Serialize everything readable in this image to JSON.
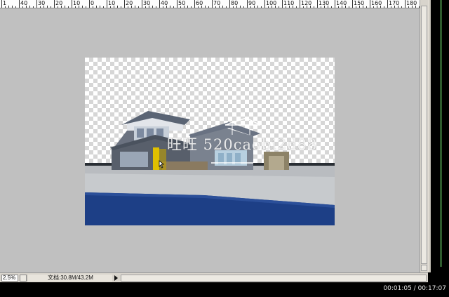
{
  "ruler": {
    "labels": [
      "1",
      "40",
      "30",
      "20",
      "10",
      "0",
      "10",
      "20",
      "30",
      "40",
      "50",
      "60",
      "70",
      "80",
      "90",
      "100",
      "110",
      "120",
      "130",
      "140",
      "150",
      "160",
      "170",
      "180"
    ]
  },
  "canvas": {
    "watermark": "旺旺 520caobi2d88"
  },
  "statusbar": {
    "zoom": "2.5%",
    "doc_info": "文档:30.8M/43.2M"
  },
  "player": {
    "time": "00:01:05 / 00:17:07"
  },
  "colors": {
    "workspace": "#c0c0c0",
    "water": "#1d3f86",
    "house_roof": "#5a6474",
    "highlight": "#e0c000"
  }
}
